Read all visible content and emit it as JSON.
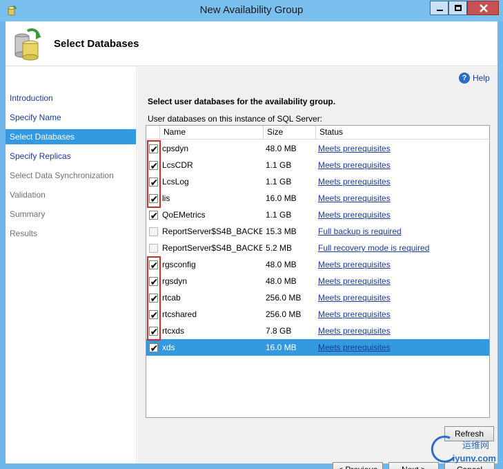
{
  "window": {
    "title": "New Availability Group"
  },
  "header": {
    "title": "Select Databases"
  },
  "nav": {
    "items": [
      {
        "label": "Introduction",
        "state": "done"
      },
      {
        "label": "Specify Name",
        "state": "done"
      },
      {
        "label": "Select Databases",
        "state": "active"
      },
      {
        "label": "Specify Replicas",
        "state": "done"
      },
      {
        "label": "Select Data Synchronization",
        "state": "pending"
      },
      {
        "label": "Validation",
        "state": "pending"
      },
      {
        "label": "Summary",
        "state": "pending"
      },
      {
        "label": "Results",
        "state": "pending"
      }
    ]
  },
  "main": {
    "help_label": "Help",
    "instruction": "Select user databases for the availability group.",
    "list_caption": "User databases on this instance of SQL Server:"
  },
  "grid": {
    "columns": {
      "name": "Name",
      "size": "Size",
      "status": "Status"
    },
    "rows": [
      {
        "checked": true,
        "name": "cpsdyn",
        "size": "48.0 MB",
        "status": "Meets prerequisites"
      },
      {
        "checked": true,
        "name": "LcsCDR",
        "size": "1.1 GB",
        "status": "Meets prerequisites"
      },
      {
        "checked": true,
        "name": "LcsLog",
        "size": "1.1 GB",
        "status": "Meets prerequisites"
      },
      {
        "checked": true,
        "name": "lis",
        "size": "16.0 MB",
        "status": "Meets prerequisites"
      },
      {
        "checked": true,
        "name": "QoEMetrics",
        "size": "1.1 GB",
        "status": "Meets prerequisites"
      },
      {
        "checked": false,
        "name": "ReportServer$S4B_BACKE...",
        "size": "15.3 MB",
        "status": "Full backup is required"
      },
      {
        "checked": false,
        "name": "ReportServer$S4B_BACKE...",
        "size": "5.2 MB",
        "status": "Full recovery mode is required"
      },
      {
        "checked": true,
        "name": "rgsconfig",
        "size": "48.0 MB",
        "status": "Meets prerequisites"
      },
      {
        "checked": true,
        "name": "rgsdyn",
        "size": "48.0 MB",
        "status": "Meets prerequisites"
      },
      {
        "checked": true,
        "name": "rtcab",
        "size": "256.0 MB",
        "status": "Meets prerequisites"
      },
      {
        "checked": true,
        "name": "rtcshared",
        "size": "256.0 MB",
        "status": "Meets prerequisites"
      },
      {
        "checked": true,
        "name": "rtcxds",
        "size": "7.8 GB",
        "status": "Meets prerequisites"
      },
      {
        "checked": true,
        "name": "xds",
        "size": "16.0 MB",
        "status": "Meets prerequisites",
        "selected": true
      }
    ]
  },
  "buttons": {
    "refresh": "Refresh",
    "previous": "< Previous",
    "next": "Next >",
    "cancel": "Cancel"
  },
  "watermark": {
    "line1": "运维网",
    "line2": "iyunv.com"
  },
  "colors": {
    "titlebar": "#7ac0ef",
    "selection": "#3399e0",
    "link": "#1a3a9c",
    "highlight_box": "#d52b2b"
  }
}
